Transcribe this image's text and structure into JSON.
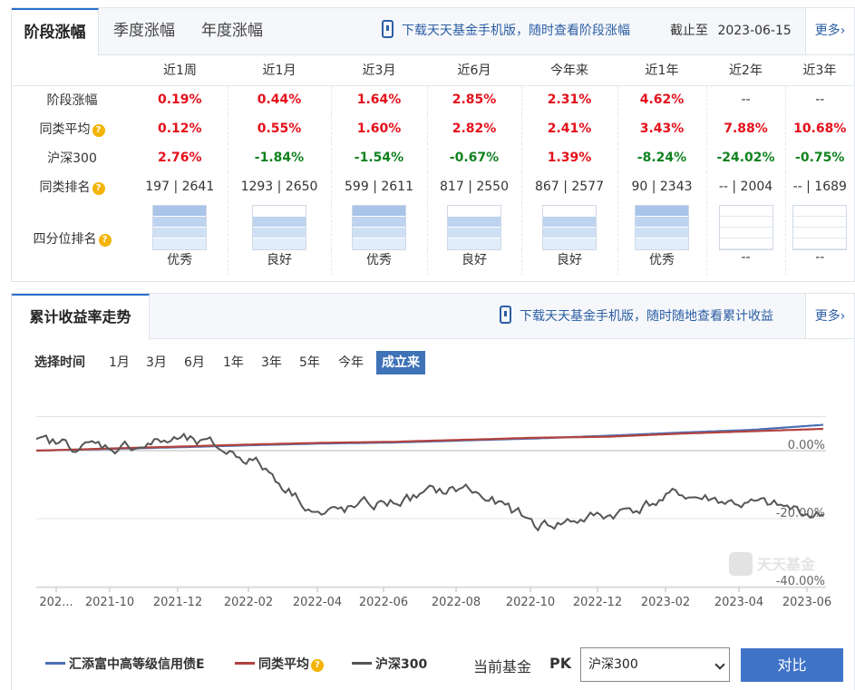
{
  "perf_panel": {
    "tabs": [
      "阶段涨幅",
      "季度涨幅",
      "年度涨幅"
    ],
    "download_text": "下载天天基金手机版，随时查看阶段涨幅",
    "as_of_label": "截止至",
    "as_of_date": "2023-06-15",
    "more": "更多",
    "columns": [
      "近1周",
      "近1月",
      "近3月",
      "近6月",
      "今年来",
      "近1年",
      "近2年",
      "近3年"
    ],
    "rows": [
      {
        "label": "阶段涨幅",
        "help": false,
        "cells": [
          {
            "v": "0.19%",
            "c": "up"
          },
          {
            "v": "0.44%",
            "c": "up"
          },
          {
            "v": "1.64%",
            "c": "up"
          },
          {
            "v": "2.85%",
            "c": "up"
          },
          {
            "v": "2.31%",
            "c": "up"
          },
          {
            "v": "4.62%",
            "c": "up"
          },
          {
            "v": "--",
            "c": "nt"
          },
          {
            "v": "--",
            "c": "nt"
          }
        ]
      },
      {
        "label": "同类平均",
        "help": true,
        "cells": [
          {
            "v": "0.12%",
            "c": "up"
          },
          {
            "v": "0.55%",
            "c": "up"
          },
          {
            "v": "1.60%",
            "c": "up"
          },
          {
            "v": "2.82%",
            "c": "up"
          },
          {
            "v": "2.41%",
            "c": "up"
          },
          {
            "v": "3.43%",
            "c": "up"
          },
          {
            "v": "7.88%",
            "c": "up"
          },
          {
            "v": "10.68%",
            "c": "up"
          }
        ]
      },
      {
        "label": "沪深300",
        "help": false,
        "cells": [
          {
            "v": "2.76%",
            "c": "up"
          },
          {
            "v": "-1.84%",
            "c": "dn"
          },
          {
            "v": "-1.54%",
            "c": "dn"
          },
          {
            "v": "-0.67%",
            "c": "dn"
          },
          {
            "v": "1.39%",
            "c": "up"
          },
          {
            "v": "-8.24%",
            "c": "dn"
          },
          {
            "v": "-24.02%",
            "c": "dn"
          },
          {
            "v": "-0.75%",
            "c": "dn"
          }
        ]
      },
      {
        "label": "同类排名",
        "help": true,
        "cells": [
          {
            "v": "197 | 2641",
            "c": "nt"
          },
          {
            "v": "1293 | 2650",
            "c": "nt"
          },
          {
            "v": "599 | 2611",
            "c": "nt"
          },
          {
            "v": "817 | 2550",
            "c": "nt"
          },
          {
            "v": "867 | 2577",
            "c": "nt"
          },
          {
            "v": "90 | 2343",
            "c": "nt"
          },
          {
            "v": "-- | 2004",
            "c": "nt"
          },
          {
            "v": "-- | 1689",
            "c": "nt"
          }
        ]
      }
    ],
    "quartile_label": "四分位排名",
    "quartile": [
      {
        "text": "优秀",
        "level": 4
      },
      {
        "text": "良好",
        "level": 3
      },
      {
        "text": "优秀",
        "level": 4
      },
      {
        "text": "良好",
        "level": 3
      },
      {
        "text": "良好",
        "level": 3
      },
      {
        "text": "优秀",
        "level": 4
      },
      {
        "text": "--",
        "level": 0
      },
      {
        "text": "--",
        "level": 0
      }
    ]
  },
  "return_panel": {
    "tab": "累计收益率走势",
    "download_text": "下载天天基金手机版，随时随地查看累计收益",
    "more": "更多",
    "range_label": "选择时间",
    "ranges": [
      "1月",
      "3月",
      "6月",
      "1年",
      "3年",
      "5年",
      "今年",
      "成立来"
    ],
    "selected_range": "成立来",
    "watermark": "天天基金",
    "compare_label": "当前基金",
    "pk": "PK",
    "select_value": "沪深300",
    "compare_button": "对比"
  },
  "chart_data": {
    "type": "line",
    "x": [
      "2021-08",
      "2021-10",
      "2021-12",
      "2022-02",
      "2022-04",
      "2022-06",
      "2022-08",
      "2022-10",
      "2022-12",
      "2023-02",
      "2023-04",
      "2023-06"
    ],
    "x_tick_labels": [
      "202...",
      "2021-10",
      "2021-12",
      "2022-02",
      "2022-04",
      "2022-06",
      "2022-08",
      "2022-10",
      "2022-12",
      "2023-02",
      "2023-04",
      "2023-06"
    ],
    "y_ticks": [
      "0.00%",
      "-20.00%",
      "-40.00%"
    ],
    "ylim": [
      -40,
      10
    ],
    "series": [
      {
        "name": "汇添富中高等级信用债E",
        "color": "#4a70b5",
        "values": [
          0,
          0.5,
          1.0,
          1.6,
          2.1,
          2.4,
          3.0,
          3.6,
          4.4,
          5.3,
          6.1,
          7.6
        ]
      },
      {
        "name": "同类平均",
        "color": "#b2423e",
        "values": [
          0,
          0.6,
          1.2,
          1.8,
          2.3,
          2.6,
          3.2,
          3.8,
          4.1,
          5.0,
          5.7,
          6.4
        ]
      },
      {
        "name": "沪深300",
        "color": "#555555",
        "values": [
          2,
          1,
          3,
          -2,
          -19,
          -15,
          -11,
          -22,
          -19,
          -13,
          -16,
          -19
        ]
      }
    ],
    "legend_help": "同类平均"
  }
}
